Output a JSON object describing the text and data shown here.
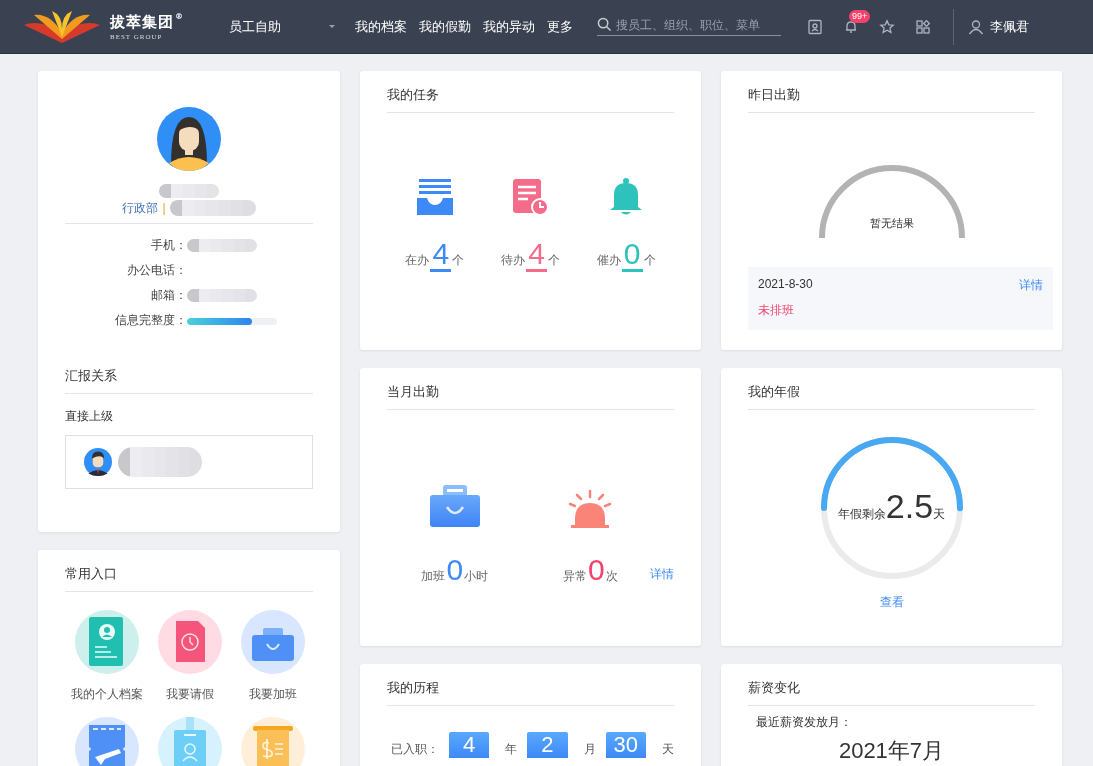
{
  "header": {
    "logo": {
      "name": "拔萃集团",
      "sub": "BEST GROUP",
      "mark": "®"
    },
    "module_switch": {
      "label": "员工自助",
      "expanded": false
    },
    "nav": [
      {
        "label": "我的档案"
      },
      {
        "label": "我的假勤"
      },
      {
        "label": "我的异动"
      },
      {
        "label": "更多"
      }
    ],
    "search": {
      "placeholder": "搜员工、组织、职位、菜单"
    },
    "notification_badge": "99+",
    "user": "李佩君"
  },
  "profile": {
    "department": "行政部",
    "separator": "|",
    "fields": [
      {
        "label": "手机：",
        "kind": "blurred"
      },
      {
        "label": "办公电话：",
        "kind": "empty"
      },
      {
        "label": "邮箱：",
        "kind": "blurred"
      },
      {
        "label": "信息完整度：",
        "kind": "progress",
        "level": 0.72
      }
    ],
    "reporting": {
      "title": "汇报关系",
      "subtitle": "直接上级"
    }
  },
  "shortcuts": {
    "title": "常用入口",
    "items": [
      {
        "kind": "profile",
        "label": "我的个人档案"
      },
      {
        "kind": "leave",
        "label": "我要请假"
      },
      {
        "kind": "overtime",
        "label": "我要加班"
      },
      {
        "kind": "travel"
      },
      {
        "kind": "badge"
      },
      {
        "kind": "salary"
      }
    ]
  },
  "tasks": {
    "title": "我的任务",
    "items": [
      {
        "kind": "inbox",
        "label": "在办",
        "count": "4",
        "unit": "个",
        "color": "#3d8af7"
      },
      {
        "kind": "pending",
        "label": "待办",
        "count": "4",
        "unit": "个",
        "color": "#f56c8a"
      },
      {
        "kind": "bell",
        "label": "催办",
        "count": "0",
        "unit": "个",
        "color": "#2ec2bd"
      }
    ]
  },
  "yesterday_attendance": {
    "title": "昨日出勤",
    "status": "暂无结果",
    "date": "2021-8-30",
    "link": "详情",
    "shift": "未排班"
  },
  "monthly_attendance": {
    "title": "当月出勤",
    "items": [
      {
        "kind": "overtime",
        "label": "加班",
        "value": "0",
        "unit": "小时",
        "color": "#3d8af7"
      },
      {
        "kind": "alarm",
        "label": "异常",
        "value": "0",
        "unit": "次",
        "color": "#f5426c"
      }
    ],
    "link": "详情"
  },
  "annual_leave": {
    "title": "我的年假",
    "label": "年假剩余",
    "value": "2.5",
    "unit": "天",
    "level": 0.5,
    "link": "查看"
  },
  "journey": {
    "title": "我的历程",
    "label": "已入职：",
    "parts": [
      {
        "value": "4",
        "unit": "年"
      },
      {
        "value": "2",
        "unit": "月"
      },
      {
        "value": "30",
        "unit": "天"
      }
    ]
  },
  "salary": {
    "title": "薪资变化",
    "label": "最近薪资发放月：",
    "month": "2021年7月"
  }
}
